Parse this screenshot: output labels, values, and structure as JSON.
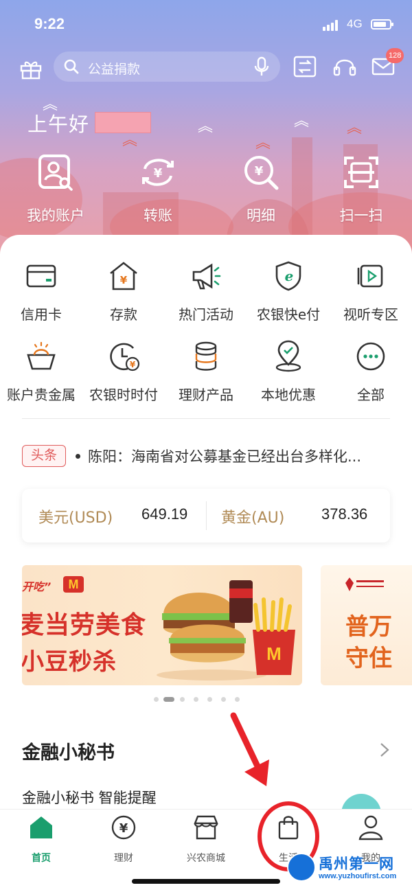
{
  "status_bar": {
    "time": "9:22",
    "network": "4G"
  },
  "header": {
    "search_placeholder": "公益捐款",
    "message_badge": "128",
    "greeting": "上午好",
    "quick_actions": [
      {
        "label": "我的账户",
        "icon": "account-icon"
      },
      {
        "label": "转账",
        "icon": "transfer-icon"
      },
      {
        "label": "明细",
        "icon": "details-icon"
      },
      {
        "label": "扫一扫",
        "icon": "scan-icon"
      }
    ]
  },
  "services": {
    "row1": [
      {
        "label": "信用卡",
        "icon": "credit-card-icon"
      },
      {
        "label": "存款",
        "icon": "deposit-icon"
      },
      {
        "label": "热门活动",
        "icon": "megaphone-icon"
      },
      {
        "label": "农银快e付",
        "icon": "e-pay-icon"
      },
      {
        "label": "视听专区",
        "icon": "video-icon"
      }
    ],
    "row2": [
      {
        "label": "账户贵金属",
        "icon": "precious-metal-icon"
      },
      {
        "label": "农银时时付",
        "icon": "clock-pay-icon"
      },
      {
        "label": "理财产品",
        "icon": "coins-icon"
      },
      {
        "label": "本地优惠",
        "icon": "location-icon"
      },
      {
        "label": "全部",
        "icon": "more-icon"
      }
    ]
  },
  "news": {
    "tag": "头条",
    "text": "陈阳：海南省对公募基金已经出台多样化..."
  },
  "rates": [
    {
      "name": "美元(USD)",
      "value": "649.19"
    },
    {
      "name": "黄金(AU)",
      "value": "378.36"
    }
  ],
  "banner": {
    "tag": "开吃”",
    "logo": "M",
    "line1": "麦当劳美食",
    "line2": "小豆秒杀",
    "side_line1": "普万",
    "side_line2": "守住",
    "dot_count": 7,
    "active_dot": 1
  },
  "secretary": {
    "title": "金融小秘书",
    "subtitle": "金融小秘书 智能提醒"
  },
  "tabs": [
    {
      "label": "首页",
      "icon": "home-icon",
      "active": true
    },
    {
      "label": "理财",
      "icon": "wealth-icon",
      "active": false
    },
    {
      "label": "兴农商城",
      "icon": "store-icon",
      "active": false
    },
    {
      "label": "生活",
      "icon": "shopping-bag-icon",
      "active": false
    },
    {
      "label": "我的",
      "icon": "profile-icon",
      "active": false
    }
  ],
  "watermark": {
    "title": "禹州第一网",
    "url": "www.yuzhoufirst.com"
  },
  "colors": {
    "accent": "#1a9e6d",
    "news_tag": "#e05a5a",
    "rate_label": "#b08a55",
    "annotation": "#e8232a"
  }
}
